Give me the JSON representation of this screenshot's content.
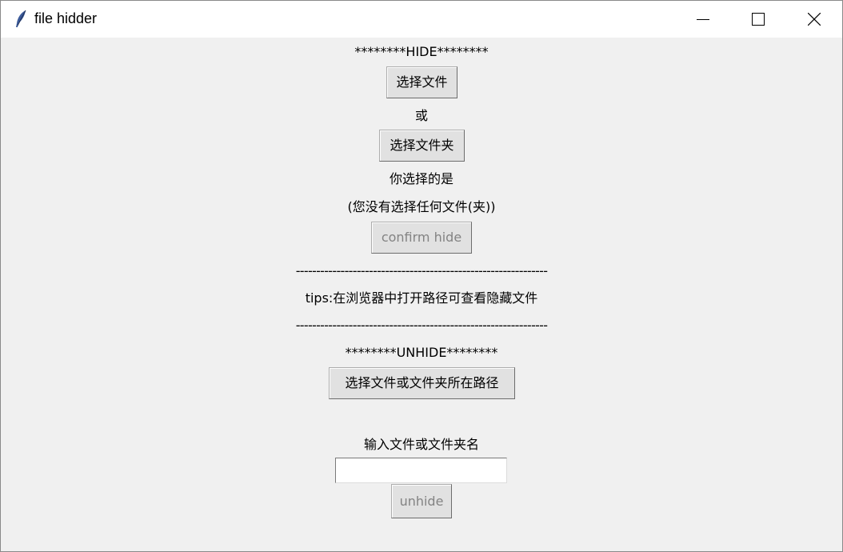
{
  "window": {
    "title": "file hidder"
  },
  "hide": {
    "header": "********HIDE********",
    "select_file_button": "选择文件",
    "or_label": "或",
    "select_folder_button": "选择文件夹",
    "you_selected_label": "你选择的是",
    "selection_text": "(您没有选择任何文件(夹))",
    "confirm_button": "confirm hide",
    "confirm_enabled": false
  },
  "separator_top": "--------------------------------------------------------------",
  "tips": "tips:在浏览器中打开路径可查看隐藏文件",
  "separator_bottom": "--------------------------------------------------------------",
  "unhide": {
    "header": "********UNHIDE********",
    "select_path_button": "选择文件或文件夹所在路径",
    "name_label": "输入文件或文件夹名",
    "name_value": "",
    "unhide_button": "unhide",
    "unhide_enabled": false
  }
}
